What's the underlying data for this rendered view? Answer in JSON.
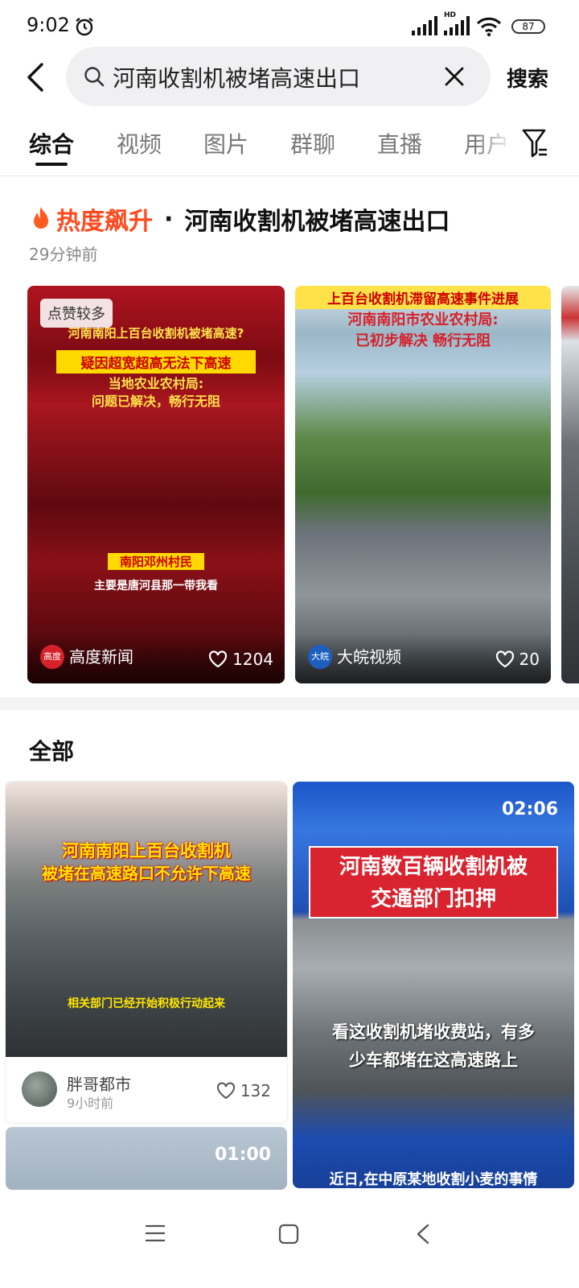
{
  "status": {
    "time": "9:02",
    "battery": "87",
    "network_label": "HD"
  },
  "search": {
    "query": "河南收割机被堵高速出口",
    "button": "搜索"
  },
  "tabs": [
    {
      "label": "综合",
      "active": true
    },
    {
      "label": "视频"
    },
    {
      "label": "图片"
    },
    {
      "label": "群聊"
    },
    {
      "label": "直播"
    },
    {
      "label": "用户"
    }
  ],
  "hot": {
    "label": "热度飙升",
    "separator": "·",
    "topic": "河南收割机被堵高速出口",
    "time": "29分钟前"
  },
  "hot_cards": [
    {
      "badge": "点赞较多",
      "overlay_lines": [
        "河南南阳上百台收割机被堵高速?",
        "疑因超宽超高无法下高速",
        "当地农业农村局:",
        "问题已解决，畅行无阻",
        "南阳邓州村民",
        "主要是唐河县那一带我看"
      ],
      "source": "高度新闻",
      "source_logo": "高度",
      "likes": "1204"
    },
    {
      "overlay_lines": [
        "上百台收割机滞留高速事件进展",
        "河南南阳市农业农村局:",
        "已初步解决 畅行无阻"
      ],
      "source": "大皖视频",
      "source_logo": "大皖",
      "likes": "20"
    }
  ],
  "section_all": "全部",
  "feed": [
    {
      "overlay_lines": [
        "河南南阳上百台收割机",
        "被堵在高速路口不允许下高速",
        "相关部门已经开始积极行动起来"
      ],
      "author": "胖哥都市",
      "posted": "9小时前",
      "likes": "132"
    },
    {
      "duration": "02:06",
      "title_lines": [
        "河南数百辆收割机被",
        "交通部门扣押"
      ],
      "caption_lines": [
        "看这收割机堵收费站，有多",
        "少车都堵在这高速路上"
      ],
      "bottom_caption": "近日,在中原某地收割小麦的事情"
    },
    {
      "duration": "01:00"
    }
  ]
}
